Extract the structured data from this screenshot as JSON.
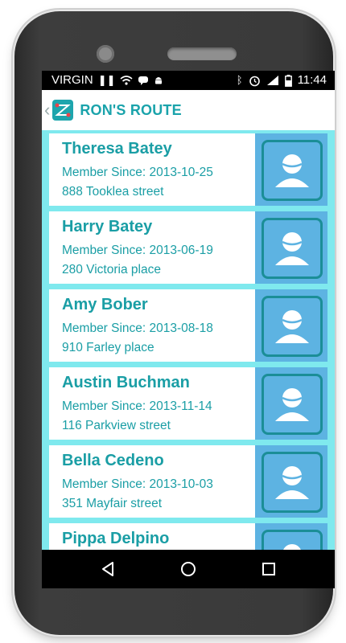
{
  "status_bar": {
    "carrier": "VIRGIN",
    "time": "11:44"
  },
  "app": {
    "title": "RON'S ROUTE",
    "accent_color": "#1aa3ab"
  },
  "members": [
    {
      "name": "Theresa Batey",
      "since": "Member Since: 2013-10-25",
      "address": "888 Tooklea street"
    },
    {
      "name": "Harry Batey",
      "since": "Member Since: 2013-06-19",
      "address": "280 Victoria place"
    },
    {
      "name": "Amy Bober",
      "since": "Member Since: 2013-08-18",
      "address": "910 Farley place"
    },
    {
      "name": "Austin Buchman",
      "since": "Member Since: 2013-11-14",
      "address": "116 Parkview street"
    },
    {
      "name": "Bella Cedeno",
      "since": "Member Since: 2013-10-03",
      "address": "351 Mayfair street"
    },
    {
      "name": "Pippa Delpino",
      "since": "",
      "address": ""
    }
  ],
  "nav": [
    "back-icon",
    "home-icon",
    "recents-icon"
  ]
}
